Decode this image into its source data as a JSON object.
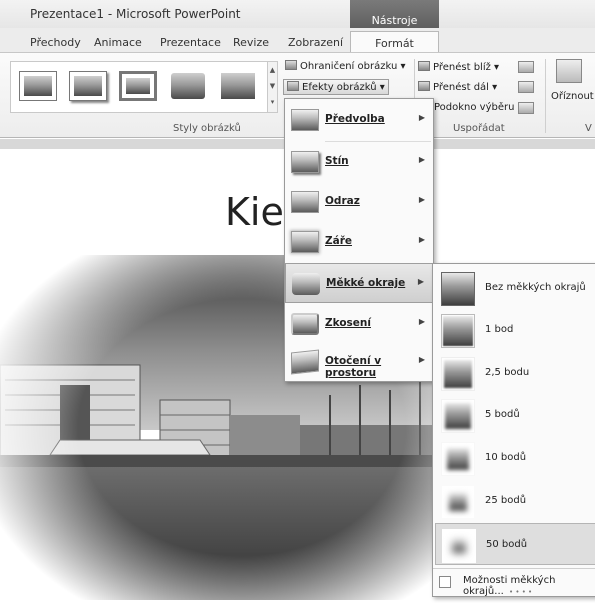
{
  "window": {
    "title": "Prezentace1 - Microsoft PowerPoint",
    "context_tab": "Nástroje obrázku"
  },
  "tabs": [
    "Přechody",
    "Animace",
    "Prezentace",
    "Revize",
    "Zobrazení",
    "Formát"
  ],
  "active_tab": "Formát",
  "ribbon": {
    "styles_label": "Styly obrázků",
    "border_btn": "Ohraničení obrázku",
    "effects_btn": "Efekty obrázků",
    "arrange_label": "Uspořádat",
    "bring_forward": "Přenést blíž",
    "send_backward": "Přenést dál",
    "selection_pane": "Podokno výběru",
    "crop": "Oříznout",
    "partial": "V"
  },
  "slide": {
    "title_visible": "Kiel"
  },
  "effects_menu": {
    "items": [
      {
        "label": "Předvolba",
        "icon": "preset-icon"
      },
      {
        "label": "Stín",
        "icon": "shadow-icon"
      },
      {
        "label": "Odraz",
        "icon": "reflection-icon"
      },
      {
        "label": "Záře",
        "icon": "glow-icon"
      },
      {
        "label": "Měkké okraje",
        "icon": "soft-edges-icon",
        "selected": true
      },
      {
        "label": "Zkosení",
        "icon": "bevel-icon"
      },
      {
        "label": "Otočení v prostoru",
        "icon": "3d-rotation-icon"
      }
    ]
  },
  "soft_edges_menu": {
    "items": [
      {
        "label": "Bez měkkých okrajů"
      },
      {
        "label": "1 bod"
      },
      {
        "label": "2,5 bodu"
      },
      {
        "label": "5 bodů"
      },
      {
        "label": "10 bodů"
      },
      {
        "label": "25 bodů"
      },
      {
        "label": "50 bodů",
        "selected": true
      }
    ],
    "more_options": "Možnosti měkkých okrajů..."
  }
}
